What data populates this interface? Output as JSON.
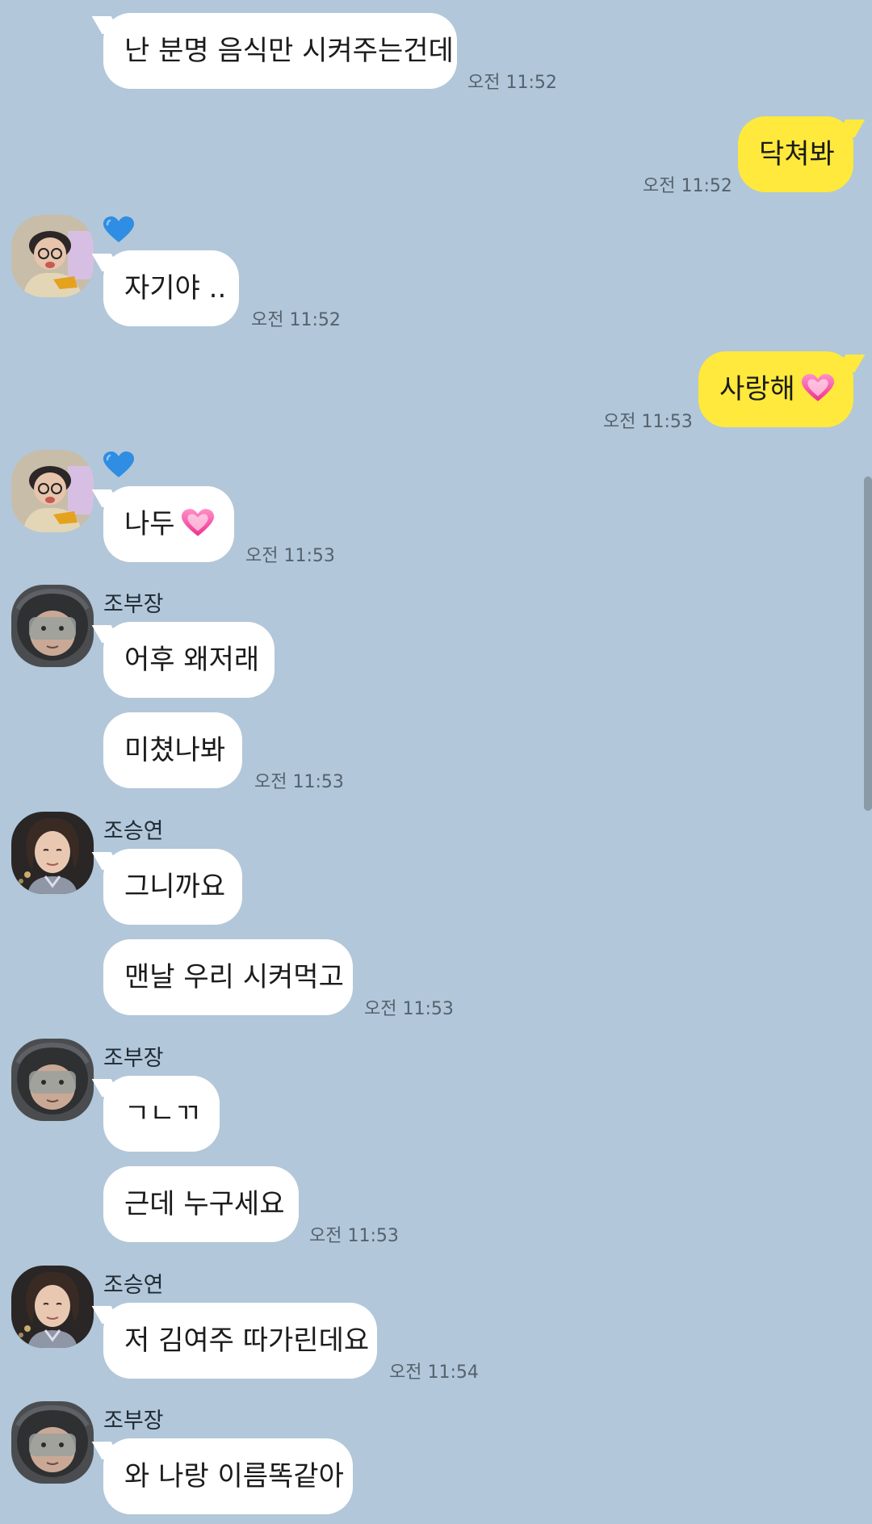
{
  "messages": [
    {
      "text": "난 분명 음식만 시켜주는건데",
      "time": "오전 11:52"
    },
    {
      "text": "닥쳐봐",
      "time": "오전 11:52"
    },
    {
      "text": "자기야 ..",
      "time": "오전 11:52"
    },
    {
      "text": "사랑해",
      "time": "오전 11:53"
    },
    {
      "text": "나두",
      "time": "오전 11:53"
    },
    {
      "sender": "조부장",
      "text": "어후 왜저래"
    },
    {
      "text": "미쳤나봐",
      "time": "오전 11:53"
    },
    {
      "sender": "조승연",
      "text": "그니까요"
    },
    {
      "text": "맨날 우리 시켜먹고",
      "time": "오전 11:53"
    },
    {
      "sender": "조부장",
      "text": "ㄱㄴㄲ"
    },
    {
      "text": "근데 누구세요",
      "time": "오전 11:53"
    },
    {
      "sender": "조승연",
      "text": "저 김여주 따가린데요",
      "time": "오전 11:54"
    },
    {
      "sender": "조부장",
      "text": "와 나랑 이름똑같아"
    }
  ],
  "colors": {
    "background": "#b2c7d9",
    "my_bubble": "#fee93c",
    "their_bubble": "#ffffff"
  }
}
